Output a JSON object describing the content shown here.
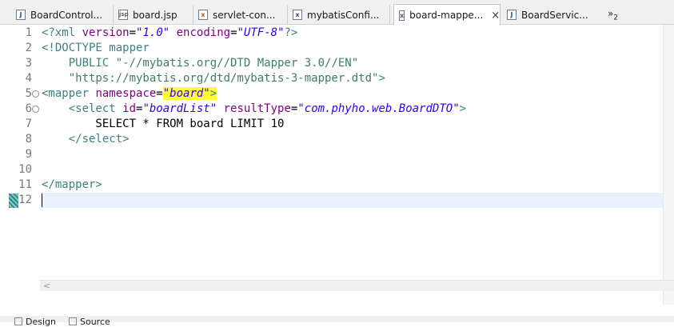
{
  "tabs": [
    {
      "label": "BoardControl...",
      "icon": "java-file-icon",
      "active": false
    },
    {
      "label": "board.jsp",
      "icon": "jsp-file-icon",
      "active": false
    },
    {
      "label": "servlet-con...",
      "icon": "xml-config-icon",
      "active": false
    },
    {
      "label": "mybatisConfi...",
      "icon": "xml-file-icon",
      "active": false
    },
    {
      "label": "board-mappe...",
      "icon": "xml-file-icon",
      "active": true,
      "close": "×"
    },
    {
      "label": "BoardServic...",
      "icon": "java-file-icon",
      "active": false
    }
  ],
  "overflow": {
    "glyph": "»",
    "count": "2"
  },
  "editor": {
    "line_numbers": [
      "1",
      "2",
      "3",
      "4",
      "5",
      "6",
      "7",
      "8",
      "9",
      "10",
      "11",
      "12"
    ],
    "lines": [
      "<?xml version=\"1.0\" encoding=\"UTF-8\"?>",
      "<!DOCTYPE mapper",
      "    PUBLIC \"-//mybatis.org//DTD Mapper 3.0//EN\"",
      "    \"https://mybatis.org/dtd/mybatis-3-mapper.dtd\">",
      "<mapper namespace=\"board\">",
      "    <select id=\"boardList\" resultType=\"com.phyho.web.BoardDTO\">",
      "        SELECT * FROM board LIMIT 10",
      "    </select>",
      "",
      "",
      "</mapper>",
      ""
    ],
    "current_line": 12
  },
  "bottom_tabs": [
    {
      "label": "Design"
    },
    {
      "label": "Source"
    }
  ],
  "colors": {
    "tag": "#3f7f7f",
    "attribute": "#7f007f",
    "value": "#2a00ff",
    "string": "#3f7f5f",
    "highlight": "#fffd38",
    "current_line": "#e8f2fe"
  }
}
